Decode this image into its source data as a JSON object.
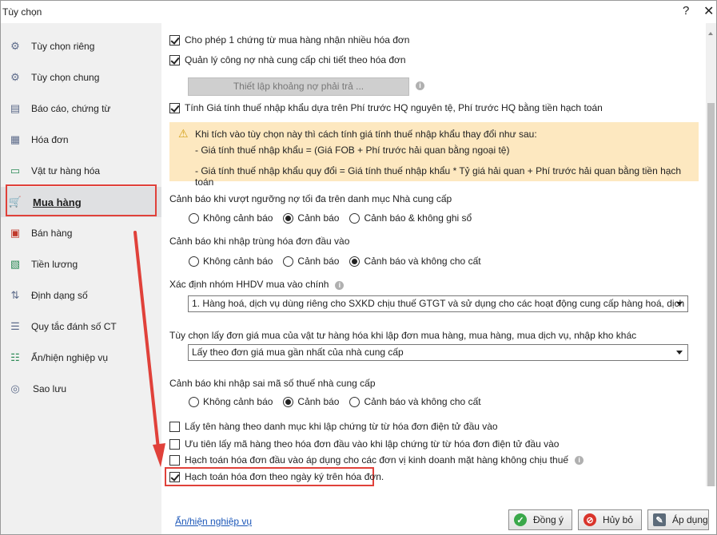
{
  "window": {
    "title": "Tùy chọn",
    "help": "?",
    "close": "✕"
  },
  "sidebar": {
    "items": [
      {
        "label": "Tùy chọn riêng",
        "icon": "gear-icon",
        "glyph": "⚙"
      },
      {
        "label": "Tùy chọn chung",
        "icon": "gear-icon",
        "glyph": "⚙"
      },
      {
        "label": "Báo cáo, chứng từ",
        "icon": "report-icon",
        "glyph": "▤"
      },
      {
        "label": "Hóa đơn",
        "icon": "invoice-icon",
        "glyph": "▦"
      },
      {
        "label": "Vật tư hàng hóa",
        "icon": "box-icon",
        "glyph": "▭"
      },
      {
        "label": "Mua hàng",
        "icon": "cart-icon",
        "glyph": "🛒",
        "active": true
      },
      {
        "label": "Bán hàng",
        "icon": "store-icon",
        "glyph": "▣"
      },
      {
        "label": "Tiền lương",
        "icon": "money-icon",
        "glyph": "▧"
      },
      {
        "label": "Định dạng số",
        "icon": "number-format-icon",
        "glyph": "⇅"
      },
      {
        "label": "Quy tắc đánh số CT",
        "icon": "numbered-list-icon",
        "glyph": "☰"
      },
      {
        "label": "Ẩn/hiện nghiệp vụ",
        "icon": "checklist-icon",
        "glyph": "☷"
      },
      {
        "label": "Sao lưu",
        "icon": "database-icon",
        "glyph": "◎"
      }
    ]
  },
  "options": {
    "cb_multi_invoice": "Cho phép 1 chứng từ mua hàng nhận nhiều hóa đơn",
    "cb_debt_detail": "Quản lý công nợ nhà cung cấp chi tiết theo hóa đơn",
    "setup_button": "Thiết lập khoảng nợ phải trả ...",
    "cb_import_tax": "Tính Giá tính thuế nhập khẩu dựa trên Phí trước HQ nguyên tệ, Phí trước HQ bằng tiền hạch toán",
    "warning": {
      "line1": "Khi tích vào tùy chọn này thì cách tính giá tính thuế nhập khẩu thay đổi như sau:",
      "line2": "- Giá tính thuế nhập khẩu = (Giá FOB + Phí trước hải quan bằng ngoại tệ)",
      "line3": "- Giá tính thuế nhập khẩu quy đổi = Giá tính thuế nhập khẩu * Tỷ giá hải quan + Phí trước hải quan bằng tiền hạch toán"
    },
    "debt_warning": {
      "label": "Cảnh báo khi vượt ngưỡng nợ tối đa trên danh mục Nhà cung cấp",
      "options": [
        "Không cảnh báo",
        "Cảnh báo",
        "Cảnh báo & không ghi sổ"
      ],
      "selected": 1
    },
    "duplicate_invoice": {
      "label": "Cảnh báo khi nhập trùng hóa đơn đầu vào",
      "options": [
        "Không cảnh báo",
        "Cảnh báo",
        "Cảnh báo và không cho cất"
      ],
      "selected": 2
    },
    "hhdv_group": {
      "label": "Xác định nhóm HHDV mua vào chính",
      "value": "1. Hàng hoá, dịch vụ dùng riêng cho SXKD chịu thuế GTGT và sử dụng cho các hoạt động cung cấp hàng hoá, dịch"
    },
    "unit_price": {
      "label": "Tùy chọn lấy đơn giá mua của vật tư hàng hóa khi lập đơn mua hàng, mua hàng, mua dịch vụ, nhập kho khác",
      "value": "Lấy theo đơn giá mua gần nhất của nhà cung cấp"
    },
    "tax_code_warning": {
      "label": "Cảnh báo khi nhập sai mã số thuế nhà cung cấp",
      "options": [
        "Không cảnh báo",
        "Cảnh báo",
        "Cảnh báo và không cho cất"
      ],
      "selected": 1
    },
    "cb_item_name": "Lấy tên hàng theo danh mục khi lập chứng từ từ hóa đơn điện tử đầu vào",
    "cb_item_code": "Ưu tiên lấy mã hàng theo hóa đơn đầu vào khi lập chứng từ từ hóa đơn điện tử đầu vào",
    "cb_non_taxable": "Hạch toán hóa đơn đầu vào áp dụng cho các đơn vị kinh doanh mặt hàng không chịu thuế",
    "cb_sign_date": "Hạch toán hóa đơn theo ngày ký trên hóa đơn."
  },
  "footer": {
    "link": "Ẩn/hiện nghiệp vụ",
    "agree": "Đồng ý",
    "cancel": "Hủy bỏ",
    "apply": "Áp dụng"
  },
  "colors": {
    "highlight": "#e0413a",
    "warning_bg": "#fde8c0",
    "link": "#1a56b8"
  }
}
